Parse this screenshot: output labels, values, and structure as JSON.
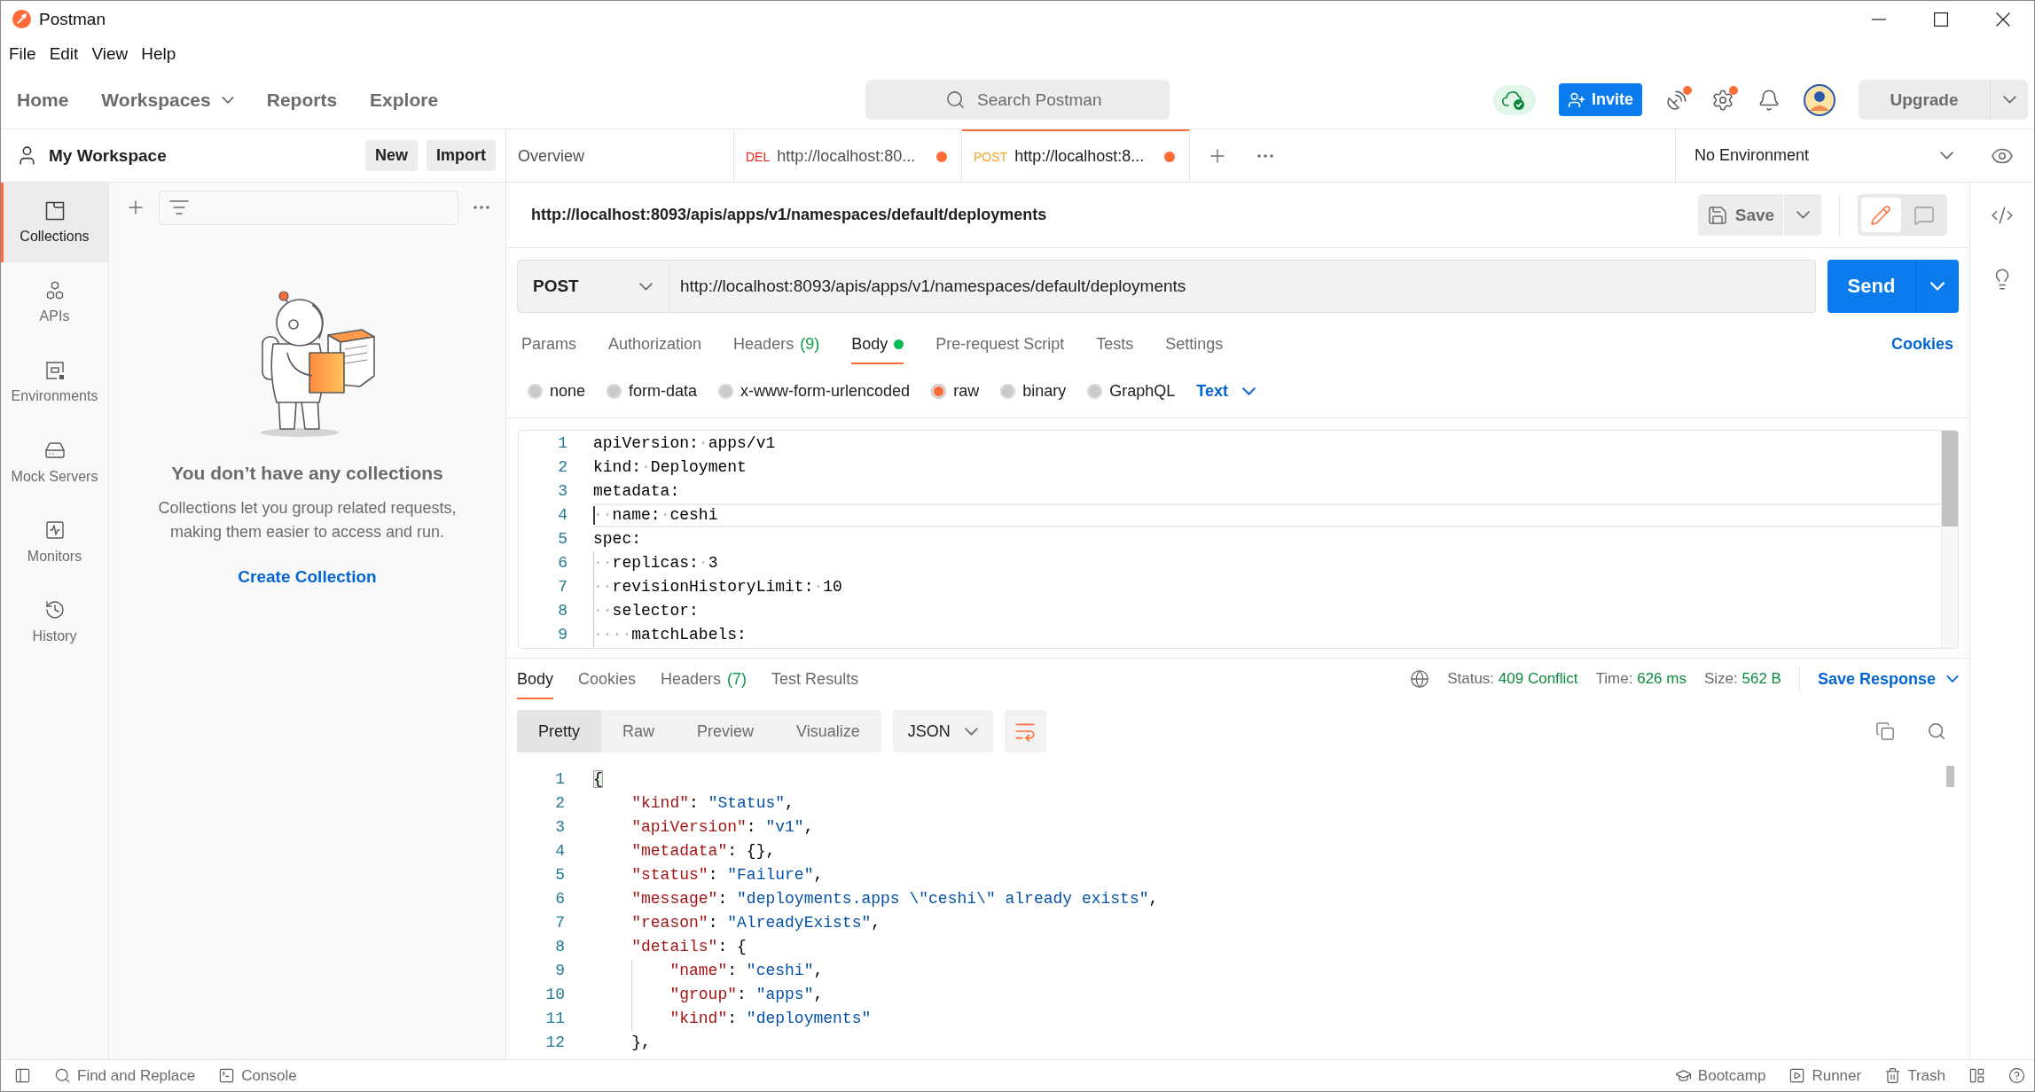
{
  "window": {
    "title": "Postman"
  },
  "menu": [
    "File",
    "Edit",
    "View",
    "Help"
  ],
  "nav": {
    "items": [
      {
        "label": "Home",
        "dropdown": false
      },
      {
        "label": "Workspaces",
        "dropdown": true
      },
      {
        "label": "Reports",
        "dropdown": false
      },
      {
        "label": "Explore",
        "dropdown": false
      }
    ],
    "search": {
      "placeholder": "Search Postman"
    },
    "invite": "Invite",
    "icons": [
      {
        "kind": "satellite",
        "notification": true
      },
      {
        "kind": "settings",
        "notification": true
      },
      {
        "kind": "bell",
        "notification": false
      }
    ],
    "upgrade": "Upgrade"
  },
  "workspace": {
    "name": "My Workspace",
    "buttons": [
      "New",
      "Import"
    ]
  },
  "sidebar": {
    "items": [
      {
        "kind": "collections",
        "label": "Collections",
        "selected": true
      },
      {
        "kind": "apis",
        "label": "APIs",
        "selected": false
      },
      {
        "kind": "environments",
        "label": "Environments",
        "selected": false
      },
      {
        "kind": "mocks",
        "label": "Mock Servers",
        "selected": false
      },
      {
        "kind": "monitors",
        "label": "Monitors",
        "selected": false
      },
      {
        "kind": "history",
        "label": "History",
        "selected": false
      }
    ],
    "empty_state": {
      "title": "You don’t have any collections",
      "text": "Collections let you group related requests, making them easier to access and run.",
      "action": "Create Collection"
    }
  },
  "tabs": [
    {
      "kind": "overview",
      "label": "Overview",
      "selected": false,
      "unsaved": false
    },
    {
      "kind": "request",
      "method": "DEL",
      "color": "#eb2013",
      "label": "http://localhost:80...",
      "selected": false,
      "unsaved": true
    },
    {
      "kind": "request",
      "method": "POST",
      "color": "#f5a623",
      "label": "http://localhost:8...",
      "selected": true,
      "unsaved": true
    }
  ],
  "environment": {
    "label": "No Environment"
  },
  "request": {
    "name": "http://localhost:8093/apis/apps/v1/namespaces/default/deployments",
    "save": "Save",
    "modes": [
      {
        "kind": "edit",
        "selected": true
      },
      {
        "kind": "comments",
        "selected": false
      }
    ],
    "method": "POST",
    "url": "http://localhost:8093/apis/apps/v1/namespaces/default/deployments",
    "send": "Send",
    "tabs": [
      {
        "label": "Params",
        "selected": false,
        "indicator": false
      },
      {
        "label": "Authorization",
        "selected": false,
        "indicator": false
      },
      {
        "label": "Headers",
        "count": "(9)",
        "selected": false,
        "indicator": false
      },
      {
        "label": "Body",
        "selected": true,
        "indicator": true
      },
      {
        "label": "Pre-request Script",
        "selected": false,
        "indicator": false
      },
      {
        "label": "Tests",
        "selected": false,
        "indicator": false
      },
      {
        "label": "Settings",
        "selected": false,
        "indicator": false
      }
    ],
    "cookies": "Cookies",
    "body_types": [
      {
        "label": "none",
        "selected": false
      },
      {
        "label": "form-data",
        "selected": false
      },
      {
        "label": "x-www-form-urlencoded",
        "selected": false
      },
      {
        "label": "raw",
        "selected": true
      },
      {
        "label": "binary",
        "selected": false
      },
      {
        "label": "GraphQL",
        "selected": false
      }
    ],
    "format": "Text",
    "editor": [
      {
        "number": "1",
        "current": false,
        "tokens": [
          {
            "kind": "text",
            "text": "apiVersion:"
          },
          {
            "kind": "space",
            "text": "·"
          },
          {
            "kind": "text",
            "text": "apps/v1"
          }
        ]
      },
      {
        "number": "2",
        "current": false,
        "tokens": [
          {
            "kind": "text",
            "text": "kind:"
          },
          {
            "kind": "space",
            "text": "·"
          },
          {
            "kind": "text",
            "text": "Deployment"
          }
        ]
      },
      {
        "number": "3",
        "current": false,
        "tokens": [
          {
            "kind": "text",
            "text": "metadata:"
          }
        ]
      },
      {
        "number": "4",
        "current": true,
        "tokens": [
          {
            "kind": "space",
            "text": "··"
          },
          {
            "kind": "text",
            "text": "name:"
          },
          {
            "kind": "space",
            "text": "·"
          },
          {
            "kind": "text",
            "text": "ceshi"
          }
        ]
      },
      {
        "number": "5",
        "current": false,
        "tokens": [
          {
            "kind": "text",
            "text": "spec:"
          }
        ]
      },
      {
        "number": "6",
        "current": false,
        "tokens": [
          {
            "kind": "guide",
            "text": "··"
          },
          {
            "kind": "text",
            "text": "replicas:"
          },
          {
            "kind": "space",
            "text": "·"
          },
          {
            "kind": "text",
            "text": "3"
          }
        ]
      },
      {
        "number": "7",
        "current": false,
        "tokens": [
          {
            "kind": "guide",
            "text": "··"
          },
          {
            "kind": "text",
            "text": "revisionHistoryLimit:"
          },
          {
            "kind": "space",
            "text": "·"
          },
          {
            "kind": "text",
            "text": "10"
          }
        ]
      },
      {
        "number": "8",
        "current": false,
        "tokens": [
          {
            "kind": "guide",
            "text": "··"
          },
          {
            "kind": "text",
            "text": "selector:"
          }
        ]
      },
      {
        "number": "9",
        "current": false,
        "tokens": [
          {
            "kind": "guide",
            "text": "··"
          },
          {
            "kind": "space",
            "text": "··"
          },
          {
            "kind": "text",
            "text": "matchLabels:"
          }
        ]
      }
    ]
  },
  "response": {
    "tabs": [
      {
        "label": "Body",
        "selected": true
      },
      {
        "label": "Cookies",
        "selected": false
      },
      {
        "label": "Headers",
        "count": "(7)",
        "selected": false
      },
      {
        "label": "Test Results",
        "selected": false
      }
    ],
    "meta": [
      {
        "label": "Status:",
        "value": "409 Conflict"
      },
      {
        "label": "Time:",
        "value": "626 ms"
      },
      {
        "label": "Size:",
        "value": "562 B"
      }
    ],
    "save": "Save Response",
    "views": [
      {
        "label": "Pretty",
        "selected": true
      },
      {
        "label": "Raw",
        "selected": false
      },
      {
        "label": "Preview",
        "selected": false
      },
      {
        "label": "Visualize",
        "selected": false
      }
    ],
    "format": "JSON",
    "wrap_lines": true,
    "lines": [
      {
        "number": "1",
        "tokens": [
          {
            "kind": "bracket",
            "text": "{"
          }
        ],
        "children": [
          {
            "number": "2",
            "tokens": [
              {
                "kind": "key",
                "text": "\"kind\""
              },
              {
                "kind": "punct",
                "text": ": "
              },
              {
                "kind": "string",
                "text": "\"Status\""
              },
              {
                "kind": "punct",
                "text": ","
              }
            ]
          },
          {
            "number": "3",
            "tokens": [
              {
                "kind": "key",
                "text": "\"apiVersion\""
              },
              {
                "kind": "punct",
                "text": ": "
              },
              {
                "kind": "string",
                "text": "\"v1\""
              },
              {
                "kind": "punct",
                "text": ","
              }
            ]
          },
          {
            "number": "4",
            "tokens": [
              {
                "kind": "key",
                "text": "\"metadata\""
              },
              {
                "kind": "punct",
                "text": ": {},"
              }
            ]
          },
          {
            "number": "5",
            "tokens": [
              {
                "kind": "key",
                "text": "\"status\""
              },
              {
                "kind": "punct",
                "text": ": "
              },
              {
                "kind": "string",
                "text": "\"Failure\""
              },
              {
                "kind": "punct",
                "text": ","
              }
            ]
          },
          {
            "number": "6",
            "tokens": [
              {
                "kind": "key",
                "text": "\"message\""
              },
              {
                "kind": "punct",
                "text": ": "
              },
              {
                "kind": "string",
                "text": "\"deployments.apps \\\"ceshi\\\" already exists\""
              },
              {
                "kind": "punct",
                "text": ","
              }
            ]
          },
          {
            "number": "7",
            "tokens": [
              {
                "kind": "key",
                "text": "\"reason\""
              },
              {
                "kind": "punct",
                "text": ": "
              },
              {
                "kind": "string",
                "text": "\"AlreadyExists\""
              },
              {
                "kind": "punct",
                "text": ","
              }
            ]
          },
          {
            "number": "8",
            "tokens": [
              {
                "kind": "key",
                "text": "\"details\""
              },
              {
                "kind": "punct",
                "text": ": {"
              }
            ],
            "children": [
              {
                "number": "9",
                "tokens": [
                  {
                    "kind": "key",
                    "text": "\"name\""
                  },
                  {
                    "kind": "punct",
                    "text": ": "
                  },
                  {
                    "kind": "string",
                    "text": "\"ceshi\""
                  },
                  {
                    "kind": "punct",
                    "text": ","
                  }
                ]
              },
              {
                "number": "10",
                "tokens": [
                  {
                    "kind": "key",
                    "text": "\"group\""
                  },
                  {
                    "kind": "punct",
                    "text": ": "
                  },
                  {
                    "kind": "string",
                    "text": "\"apps\""
                  },
                  {
                    "kind": "punct",
                    "text": ","
                  }
                ]
              },
              {
                "number": "11",
                "tokens": [
                  {
                    "kind": "key",
                    "text": "\"kind\""
                  },
                  {
                    "kind": "punct",
                    "text": ": "
                  },
                  {
                    "kind": "string",
                    "text": "\"deployments\""
                  }
                ]
              }
            ]
          },
          {
            "number": "12",
            "tokens": [
              {
                "kind": "punct",
                "text": "},"
              }
            ]
          }
        ]
      }
    ]
  },
  "status_bar": {
    "left": [
      {
        "kind": "find",
        "label": "Find and Replace"
      },
      {
        "kind": "console",
        "label": "Console"
      }
    ],
    "right": [
      {
        "kind": "bootcamp",
        "label": "Bootcamp"
      },
      {
        "kind": "runner",
        "label": "Runner"
      },
      {
        "kind": "trash",
        "label": "Trash"
      }
    ]
  }
}
